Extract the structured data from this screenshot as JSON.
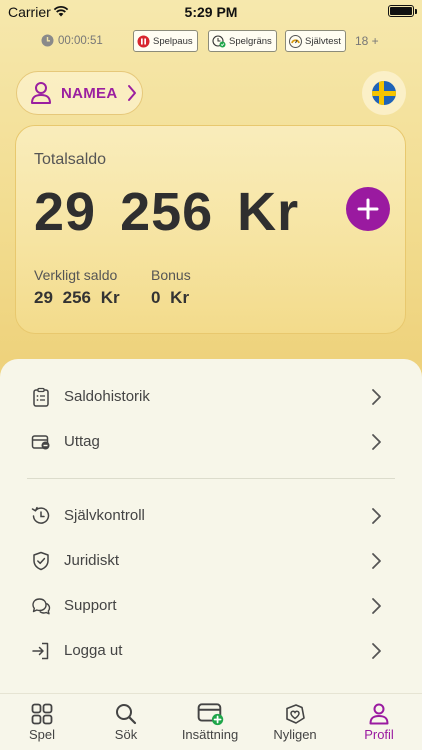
{
  "status_bar": {
    "carrier": "Carrier",
    "time": "5:29 PM"
  },
  "responsible_gaming": {
    "timer": "00:00:51",
    "chips": [
      {
        "label": "Spelpaus",
        "icon": "spelpaus-icon"
      },
      {
        "label": "Spelgräns",
        "icon": "spelgrans-icon"
      },
      {
        "label": "Självtest",
        "icon": "sjalvtest-icon"
      }
    ],
    "age_limit": "18 +"
  },
  "header": {
    "brand_label": "NAMEA",
    "language_flag": "sweden-flag-icon"
  },
  "balance": {
    "title": "Totalsaldo",
    "total": "29 256  Kr",
    "real_label": "Verkligt saldo",
    "real_value": "29 256  Kr",
    "bonus_label": "Bonus",
    "bonus_value": "0  Kr"
  },
  "menu": {
    "items": [
      {
        "label": "Saldohistorik",
        "icon": "clipboard-icon"
      },
      {
        "label": "Uttag",
        "icon": "withdraw-card-icon"
      },
      {
        "label": "Självkontroll",
        "icon": "self-control-icon"
      },
      {
        "label": "Juridiskt",
        "icon": "shield-check-icon"
      },
      {
        "label": "Support",
        "icon": "chat-bubbles-icon"
      },
      {
        "label": "Logga ut",
        "icon": "logout-icon"
      }
    ]
  },
  "tabs": [
    {
      "label": "Spel",
      "icon": "grid-icon"
    },
    {
      "label": "Sök",
      "icon": "search-icon"
    },
    {
      "label": "Insättning",
      "icon": "deposit-card-icon"
    },
    {
      "label": "Nyligen",
      "icon": "heart-icon"
    },
    {
      "label": "Profil",
      "icon": "profile-icon",
      "active": true
    }
  ],
  "colors": {
    "accent": "#9a1aa0",
    "deposit_green": "#1fa64a",
    "card_border": "#e8c86e"
  }
}
